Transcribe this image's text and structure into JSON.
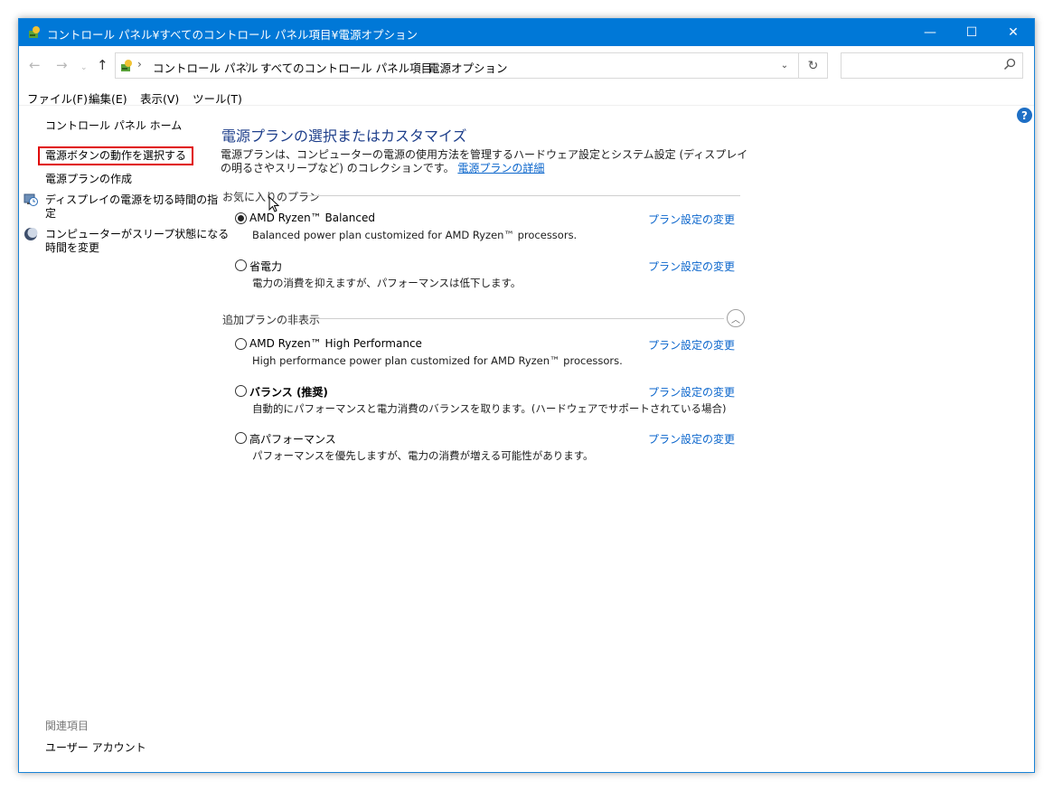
{
  "window": {
    "title": "コントロール パネル¥すべてのコントロール パネル項目¥電源オプション",
    "controls": {
      "minimize": "—",
      "maximize": "☐",
      "close": "✕"
    }
  },
  "navigation": {
    "back": "←",
    "forward": "→",
    "recent": "⌄",
    "up": "↑",
    "breadcrumbs": [
      "コントロール パネル",
      "すべてのコントロール パネル項目",
      "電源オプション"
    ],
    "separator": "›",
    "dropdown": "⌄",
    "refresh": "↻",
    "search_placeholder": ""
  },
  "menubar": {
    "items": [
      "ファイル(F)",
      "編集(E)",
      "表示(V)",
      "ツール(T)"
    ]
  },
  "help": {
    "label": "?"
  },
  "sidebar": {
    "home": "コントロール パネル ホーム",
    "items": [
      {
        "label": "電源ボタンの動作を選択する",
        "icon": null
      },
      {
        "label": "電源プランの作成",
        "icon": null
      },
      {
        "label_lines": [
          "ディスプレイの電源を切る時間の指",
          "定"
        ],
        "icon": "display-clock-icon"
      },
      {
        "label_lines": [
          "コンピューターがスリープ状態になる",
          "時間を変更"
        ],
        "icon": "sleep-moon-icon"
      }
    ],
    "related_heading": "関連項目",
    "related_items": [
      "ユーザー アカウント"
    ]
  },
  "main": {
    "title": "電源プランの選択またはカスタマイズ",
    "description": "電源プランは、コンピューターの電源の使用方法を管理するハードウェア設定とシステム設定 (ディスプレイの明るさやスリープなど) のコレクションです。",
    "description_link": "電源プランの詳細",
    "favorites_heading": "お気に入りのプラン",
    "additional_heading": "追加プランの非表示",
    "collapse_icon": "︿",
    "change_label": "プラン設定の変更",
    "favorite_plans": [
      {
        "name": "AMD Ryzen™ Balanced",
        "desc": "Balanced power plan customized for AMD Ryzen™ processors.",
        "selected": true
      },
      {
        "name": "省電力",
        "desc": "電力の消費を抑えますが、パフォーマンスは低下します。",
        "selected": false
      }
    ],
    "additional_plans": [
      {
        "name": "AMD Ryzen™ High Performance",
        "desc": "High performance power plan customized for AMD Ryzen™ processors.",
        "selected": false
      },
      {
        "name": "バランス (推奨)",
        "desc": "自動的にパフォーマンスと電力消費のバランスを取ります。(ハードウェアでサポートされている場合)",
        "selected": false
      },
      {
        "name": "高パフォーマンス",
        "desc": "パフォーマンスを優先しますが、電力の消費が増える可能性があります。",
        "selected": false
      }
    ]
  },
  "colors": {
    "titlebar": "#0078d7",
    "link": "#0b66cc",
    "heading": "#1e3f8b",
    "highlight_border": "#e00000"
  }
}
